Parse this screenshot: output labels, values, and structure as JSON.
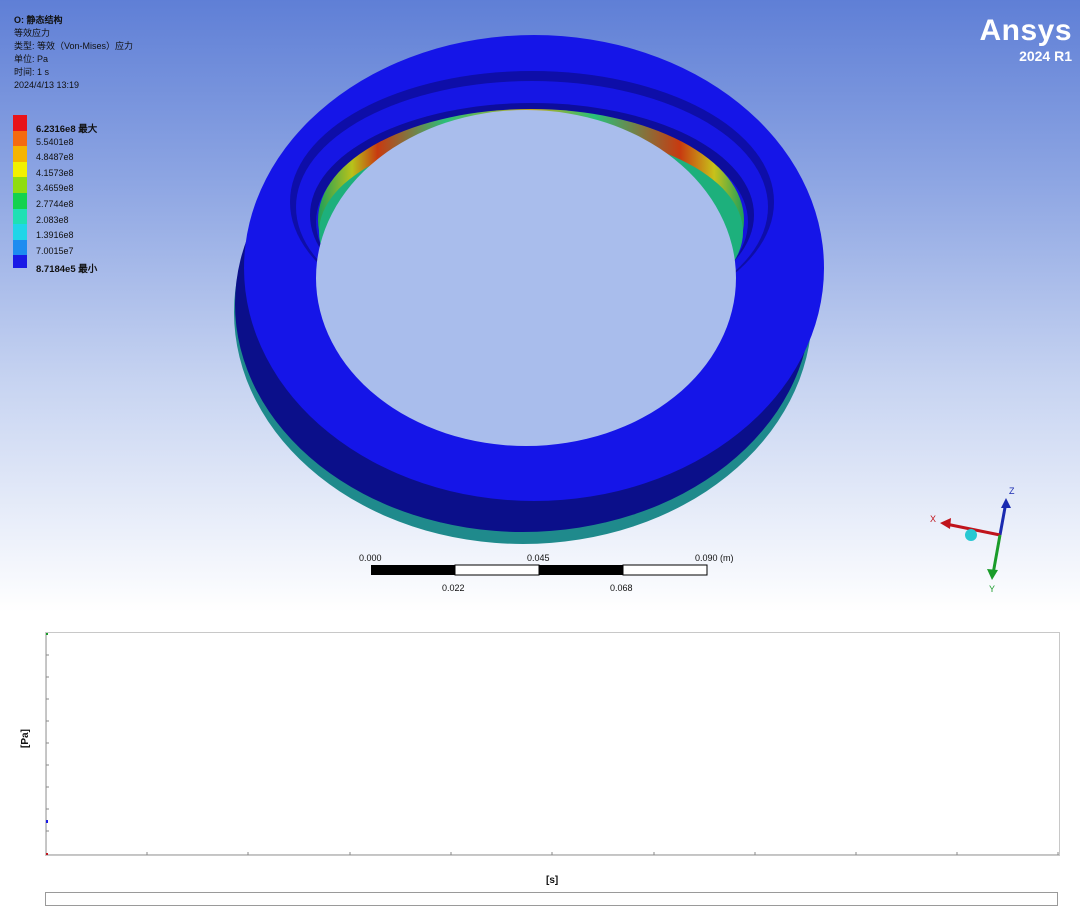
{
  "result_info": {
    "title": "O: 静态结构",
    "result_name": "等效应力",
    "type_line": "类型: 等效（Von-Mises）应力",
    "unit_line": "单位: Pa",
    "time_line": "时间: 1 s",
    "date_line": "2024/4/13 13:19"
  },
  "legend": [
    {
      "label": "6.2316e8 最大",
      "color": "#e8131a",
      "strong": true
    },
    {
      "label": "5.5401e8",
      "color": "#f46a10",
      "strong": false
    },
    {
      "label": "4.8487e8",
      "color": "#f5b400",
      "strong": false
    },
    {
      "label": "4.1573e8",
      "color": "#f3f000",
      "strong": false
    },
    {
      "label": "3.4659e8",
      "color": "#8fdc12",
      "strong": false
    },
    {
      "label": "2.7744e8",
      "color": "#14d24e",
      "strong": false
    },
    {
      "label": "2.083e8",
      "color": "#1fe0b4",
      "strong": false
    },
    {
      "label": "1.3916e8",
      "color": "#20d6e8",
      "strong": false
    },
    {
      "label": "7.0015e7",
      "color": "#1d8cf0",
      "strong": false
    },
    {
      "label": "8.7184e5 最小",
      "color": "#1a1ae6",
      "strong": true
    }
  ],
  "brand": {
    "name": "Ansys",
    "version": "2024 R1"
  },
  "scale_bar": {
    "top_labels": [
      "0.000",
      "0.045",
      "0.090 (m)"
    ],
    "bottom_labels": [
      "0.022",
      "0.068"
    ]
  },
  "triad": {
    "x_label": "X",
    "y_label": "Y",
    "z_label": "Z",
    "x_color": "#c0141c",
    "y_color": "#1a9c2a",
    "z_color": "#1a2ab0"
  },
  "chart": {
    "y_axis_label": "[Pa]",
    "x_axis_label": "[s]"
  },
  "colors": {
    "model_blue": "#1414e6",
    "model_shadow": "#0a0a7a"
  }
}
